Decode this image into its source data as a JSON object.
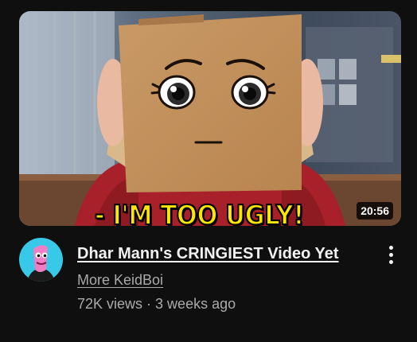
{
  "video": {
    "thumbnail_caption": "- I'M TOO UGLY!",
    "duration": "20:56",
    "title": "Dhar Mann's CRINGIEST Video Yet",
    "channel": "More KeidBoi",
    "views": "72K views",
    "separator": "·",
    "age": "3 weeks ago"
  },
  "icons": {
    "menu": "more-vert-icon"
  },
  "colors": {
    "background": "#0f0f0f",
    "title": "#f1f1f1",
    "secondary_text": "#aaaaaa",
    "caption": "#ffe600"
  }
}
